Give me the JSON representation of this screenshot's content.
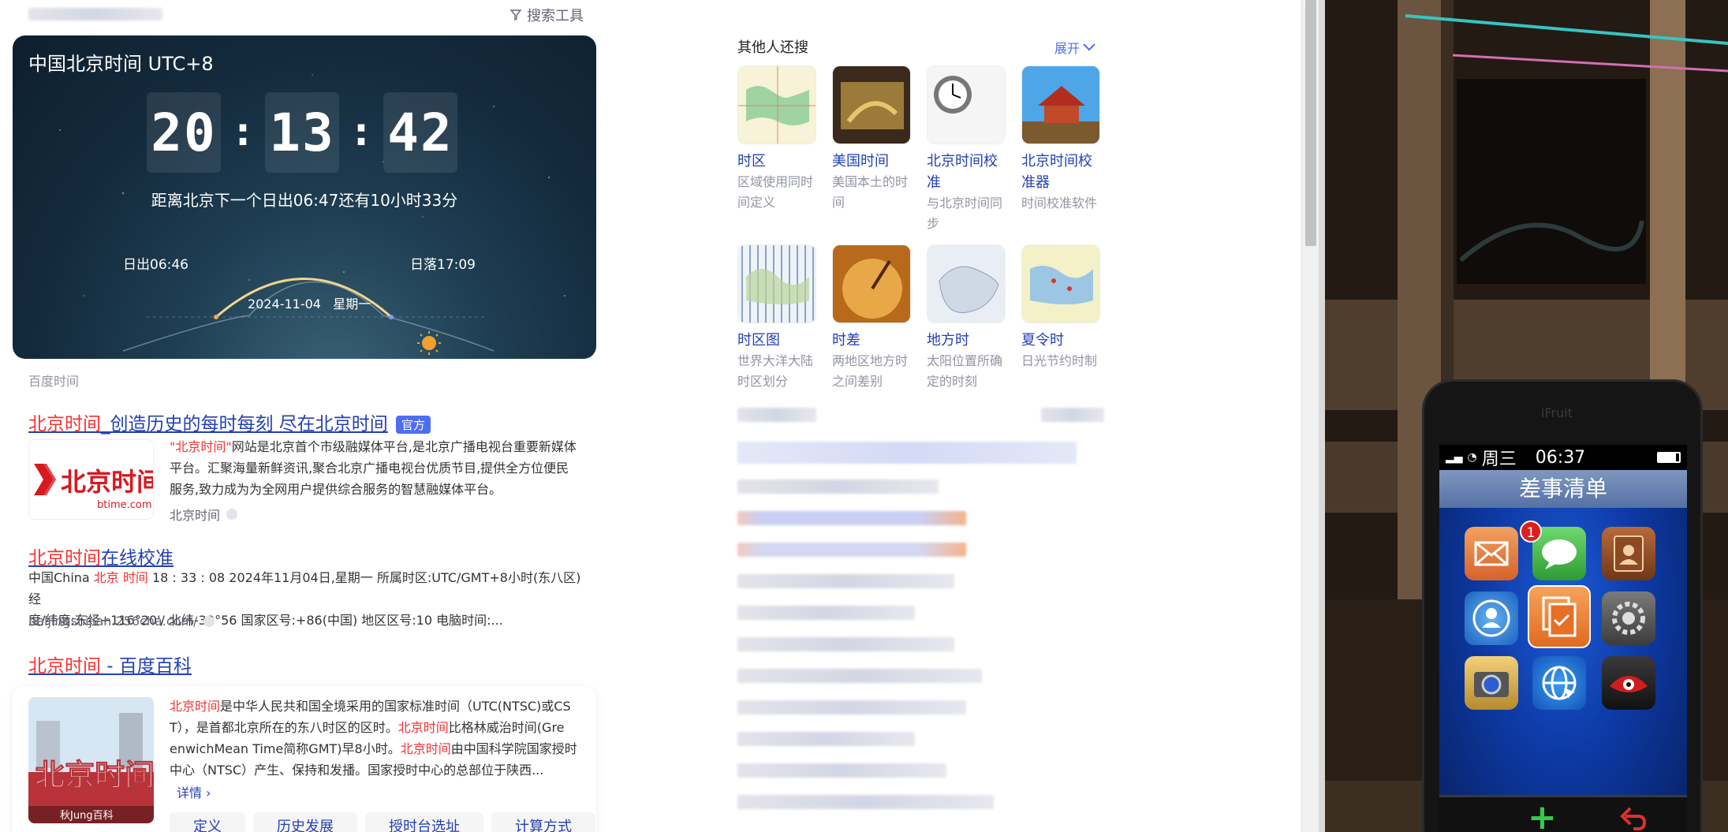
{
  "search_tools_label": "搜索工具",
  "time_card": {
    "title": "中国北京时间 UTC+8",
    "hours": "20",
    "minutes": "13",
    "seconds": "42",
    "separator": ":",
    "next_sunrise": "距离北京下一个日出06:47还有10小时33分",
    "sunrise": "日出06:46",
    "sunset": "日落17:09",
    "date": "2024-11-04",
    "weekday": "星期一"
  },
  "source_label": "百度时间",
  "results": [
    {
      "title_hl": "北京时间",
      "title_rest": "_创造历史的每时每刻 尽在北京时间",
      "badge": "官方",
      "lines": [
        {
          "hl": "\"北京时间\"",
          "text": "网站是北京首个市级融媒体平台,是北京广播电视台重要新媒体"
        },
        {
          "hl": "",
          "text": "平台。汇聚海量新鲜资讯,聚合北京广播电视台优质节目,提供全方位便民"
        },
        {
          "hl": "",
          "text": "服务,致力成为为全网用户提供综合服务的智慧融媒体平台。"
        }
      ],
      "site": "北京时间",
      "logo_main": "北京时间",
      "logo_sub": "btime.com"
    },
    {
      "title_hl": "北京时间",
      "title_rest": "在线校准",
      "line1_pre": "中国China ",
      "line1_hl": "北京 时间",
      "line1_post": " 18 : 33 : 08 2024年11月04日,星期一 所属时区:UTC/GMT+8小时(东八区) 经",
      "line2": "度/纬度:东经+116°20'/ 北纬-39°56 国家区号:+86(中国) 地区区号:10 电脑时间:...",
      "site": "beijingshijian.256cha.com/"
    },
    {
      "title_hl": "北京时间",
      "title_rest": " - 百度百科",
      "lines": [
        {
          "hl": "北京时间",
          "text": "是中华人民共和国全境采用的国家标准时间（UTC(NTSC)或CS"
        },
        {
          "hl": "",
          "text": "T），是首都北京所在的东八时区的区时。",
          "hl2": "北京时间",
          "text2": "比格林威治时间(Gre"
        },
        {
          "hl": "",
          "text": "enwichMean Time简称GMT)早8小时。",
          "hl2": "北京时间",
          "text2": "由中国科学院国家授时"
        },
        {
          "hl": "",
          "text": "中心（NTSC）产生、保持和发播。国家授时中心的总部位于陕西..."
        }
      ],
      "detail": "详情 ›",
      "image_caption": "秋Jung百科",
      "tabs": [
        "定义",
        "历史发展",
        "授时台选址",
        "计算方式"
      ]
    }
  ],
  "others": {
    "title": "其他人还搜",
    "expand": "展开",
    "items": [
      {
        "name": "时区",
        "desc": [
          "区域使用同时",
          "间定义"
        ],
        "img": "map"
      },
      {
        "name": "美国时间",
        "desc": [
          "美国本土的时",
          "间"
        ],
        "img": "usa"
      },
      {
        "name": "北京时间校",
        "name2": "准",
        "desc": [
          "与北京时间同",
          "步"
        ],
        "img": "clock"
      },
      {
        "name": "北京时间校",
        "name2": "准器",
        "desc": [
          "时间校准软件"
        ],
        "img": "palace"
      },
      {
        "name": "时区图",
        "desc": [
          "世界大洋大陆",
          "时区划分"
        ],
        "img": "tzmap"
      },
      {
        "name": "时差",
        "desc": [
          "两地区地方时",
          "之间差别"
        ],
        "img": "sundial"
      },
      {
        "name": "地方时",
        "desc": [
          "太阳位置所确",
          "定的时刻"
        ],
        "img": "china"
      },
      {
        "name": "夏令时",
        "desc": [
          "日光节约时制"
        ],
        "img": "dst"
      }
    ]
  },
  "phone": {
    "brand": "iFruit",
    "day": "周三",
    "time": "06:37",
    "header": "差事清单",
    "badge_count": "1",
    "plus": "+",
    "colors": {
      "screen": "#0d3aa6",
      "header": "#6a83b3",
      "badge": "#e01d1d"
    }
  }
}
